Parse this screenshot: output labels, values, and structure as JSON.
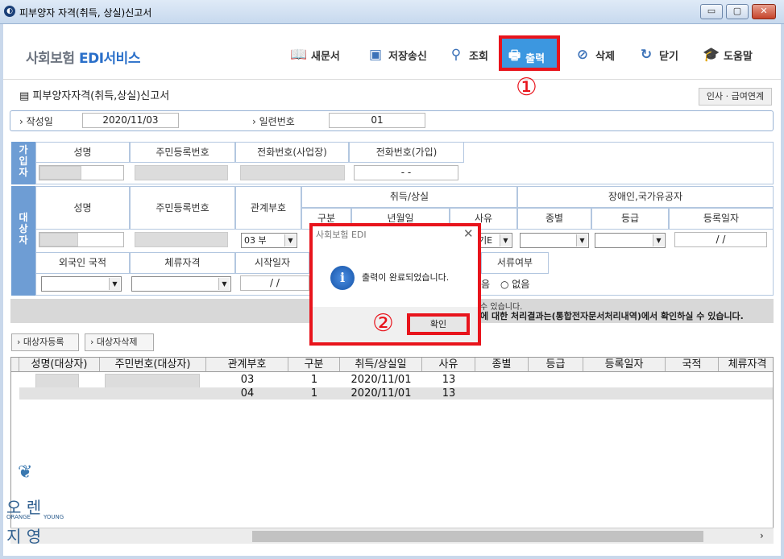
{
  "window": {
    "title": "피부양자 자격(취득, 상실)신고서",
    "buttons": [
      "▭",
      "▢",
      "✕"
    ]
  },
  "brand": {
    "prefix": "사회보험 ",
    "highlight": "EDI서비스"
  },
  "toolbar": {
    "new_doc": "새문서",
    "save_send": "저장송신",
    "search": "조회",
    "print": "출력",
    "delete": "삭제",
    "close": "닫기",
    "help": "도움말"
  },
  "annotations": {
    "one": "①",
    "two": "②"
  },
  "section": {
    "title": "피부양자자격(취득,상실)신고서",
    "link": "인사 · 급여연계"
  },
  "info": {
    "date_label": "작성일",
    "date_value": "2020/11/03",
    "serial_label": "일련번호",
    "serial_value": "01"
  },
  "subscriber": {
    "side_label": "가\n입\n자",
    "headers": [
      "성명",
      "주민등록번호",
      "전화번호(사업장)",
      "전화번호(가입)"
    ],
    "phone_value": "-         -"
  },
  "target": {
    "side_label": "대\n상\n자",
    "headers": {
      "name": "성명",
      "rrn": "주민등록번호",
      "relation": "관계부호",
      "acq_loss": "취득/상실",
      "disabled": "장애인,국가유공자",
      "div": "구분",
      "date": "년월일",
      "reason": "사유",
      "type": "종별",
      "grade": "등급",
      "reg_date": "등록일자",
      "nationality": "외국인 국적",
      "stay": "체류자격",
      "start": "시작일자",
      "docs": "서류여부"
    },
    "relation_value": "03   부",
    "reason_value": "기E",
    "reg_date_value": "/ /",
    "start_value": "/ /",
    "docs_options": {
      "yes": "음",
      "no": "없음"
    }
  },
  "notice": {
    "line1": "수 있습니다.",
    "line2": "에 대한 처리결과는(통합전자문서처리내역)에서 확인하실 수 있습니다."
  },
  "buttons": {
    "add_target": "대상자등록",
    "del_target": "대상자삭제"
  },
  "grid": {
    "headers": [
      "성명(대상자)",
      "주민번호(대상자)",
      "관계부호",
      "구분",
      "취득/상실일",
      "사유",
      "종별",
      "등급",
      "등록일자",
      "국적",
      "체류자격"
    ],
    "rows": [
      [
        "",
        "",
        "03",
        "1",
        "2020/11/01",
        "13"
      ],
      [
        "",
        "",
        "04",
        "1",
        "2020/11/01",
        "13"
      ]
    ]
  },
  "dialog": {
    "title": "사회보험 EDI",
    "message": "출력이 완료되었습니다.",
    "ok": "확인",
    "close": "✕"
  },
  "logo": {
    "line1": "오  렌",
    "line2": "지  영",
    "en1": "ORANGE",
    "en2": "YOUNG"
  }
}
